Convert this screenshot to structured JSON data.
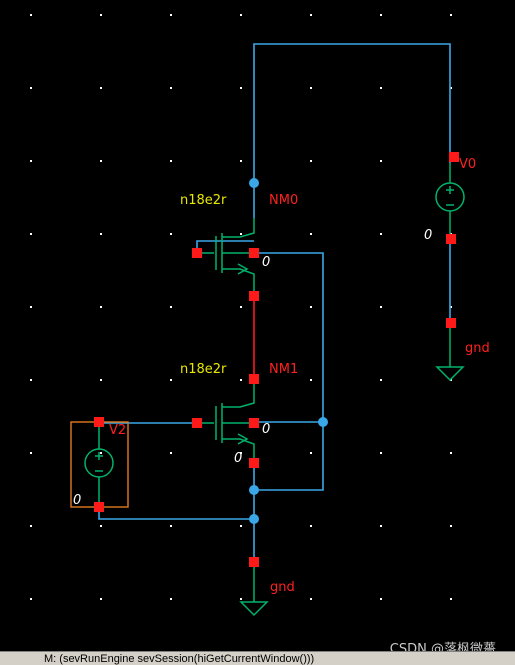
{
  "colors": {
    "background": "#000000",
    "wire": "#3aa8e8",
    "pin": "#ff1a1a",
    "device": "#00b36b",
    "source_box": "#e07a20",
    "model_text": "#e8e800",
    "instance_text": "#ff2020",
    "gnd_text": "#ff2020",
    "dot_text": "#ffffff"
  },
  "schematic": {
    "nm0": {
      "model": "n18e2r",
      "instance": "NM0",
      "bulk_label": "0"
    },
    "nm1": {
      "model": "n18e2r",
      "instance": "NM1",
      "bulk_label": "0",
      "bulk_label2": "0"
    },
    "v0": {
      "instance": "V0",
      "neg_label": "0",
      "gnd_label": "gnd"
    },
    "v2": {
      "instance": "V2",
      "neg_label": "0"
    },
    "bottom_gnd": {
      "label": "gnd"
    }
  },
  "status_bar": {
    "text": "M: (sevRunEngine sevSession(hiGetCurrentWindow()))"
  },
  "watermark": {
    "text": "CSDN @落枫微薔"
  },
  "icons": [
    "ground-icon",
    "voltage-source-icon",
    "nmos-icon"
  ]
}
